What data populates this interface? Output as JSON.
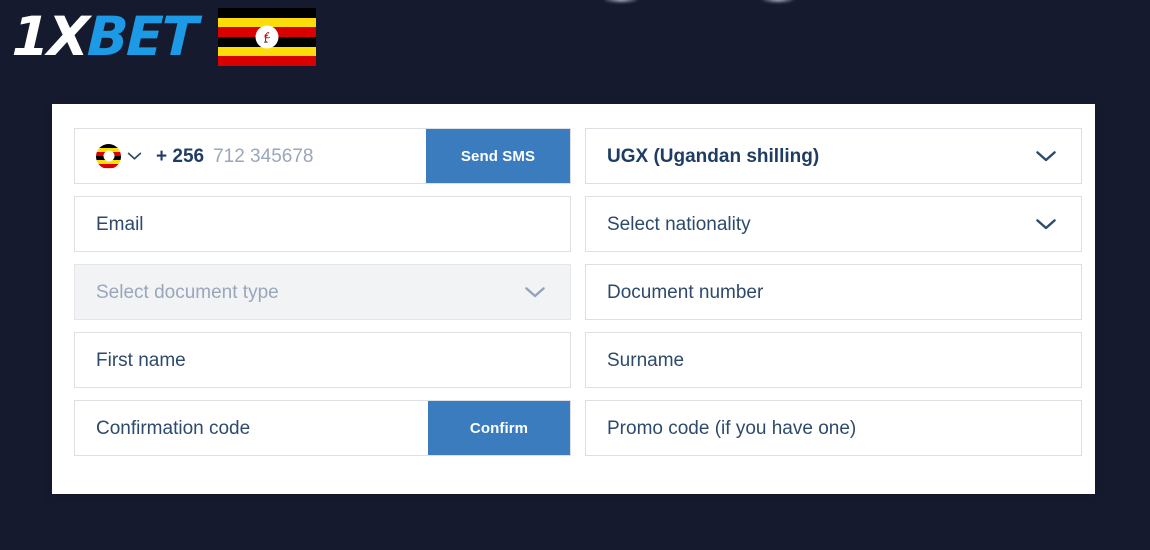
{
  "page": {
    "background_color": "#161a2e",
    "card_background": "#ffffff"
  },
  "header": {
    "logo": {
      "part1": "1X",
      "part2": "BET",
      "part1_color": "#ffffff",
      "part2_color": "#1c9ae5"
    },
    "flag_name": "uganda-flag"
  },
  "form": {
    "phone": {
      "country_flag": "uganda-flag-circle",
      "dial_code": "+ 256",
      "placeholder": "712 345678",
      "button_label": "Send SMS"
    },
    "currency": {
      "value": "UGX (Ugandan shilling)",
      "caret": "chevron-down-icon"
    },
    "email": {
      "placeholder": "Email"
    },
    "nationality": {
      "placeholder": "Select nationality",
      "caret": "chevron-down-icon"
    },
    "document_type": {
      "placeholder": "Select document type",
      "caret": "chevron-down-icon",
      "disabled": true
    },
    "document_number": {
      "placeholder": "Document number"
    },
    "first_name": {
      "placeholder": "First name"
    },
    "surname": {
      "placeholder": "Surname"
    },
    "confirmation_code": {
      "placeholder": "Confirmation code",
      "button_label": "Confirm"
    },
    "promo_code": {
      "placeholder": "Promo code (if you have one)"
    }
  },
  "colors": {
    "accent_blue": "#3a7cbd",
    "text_navy": "#2d4a6b",
    "text_muted": "#9aa6bb",
    "border": "#dcdfe3"
  }
}
